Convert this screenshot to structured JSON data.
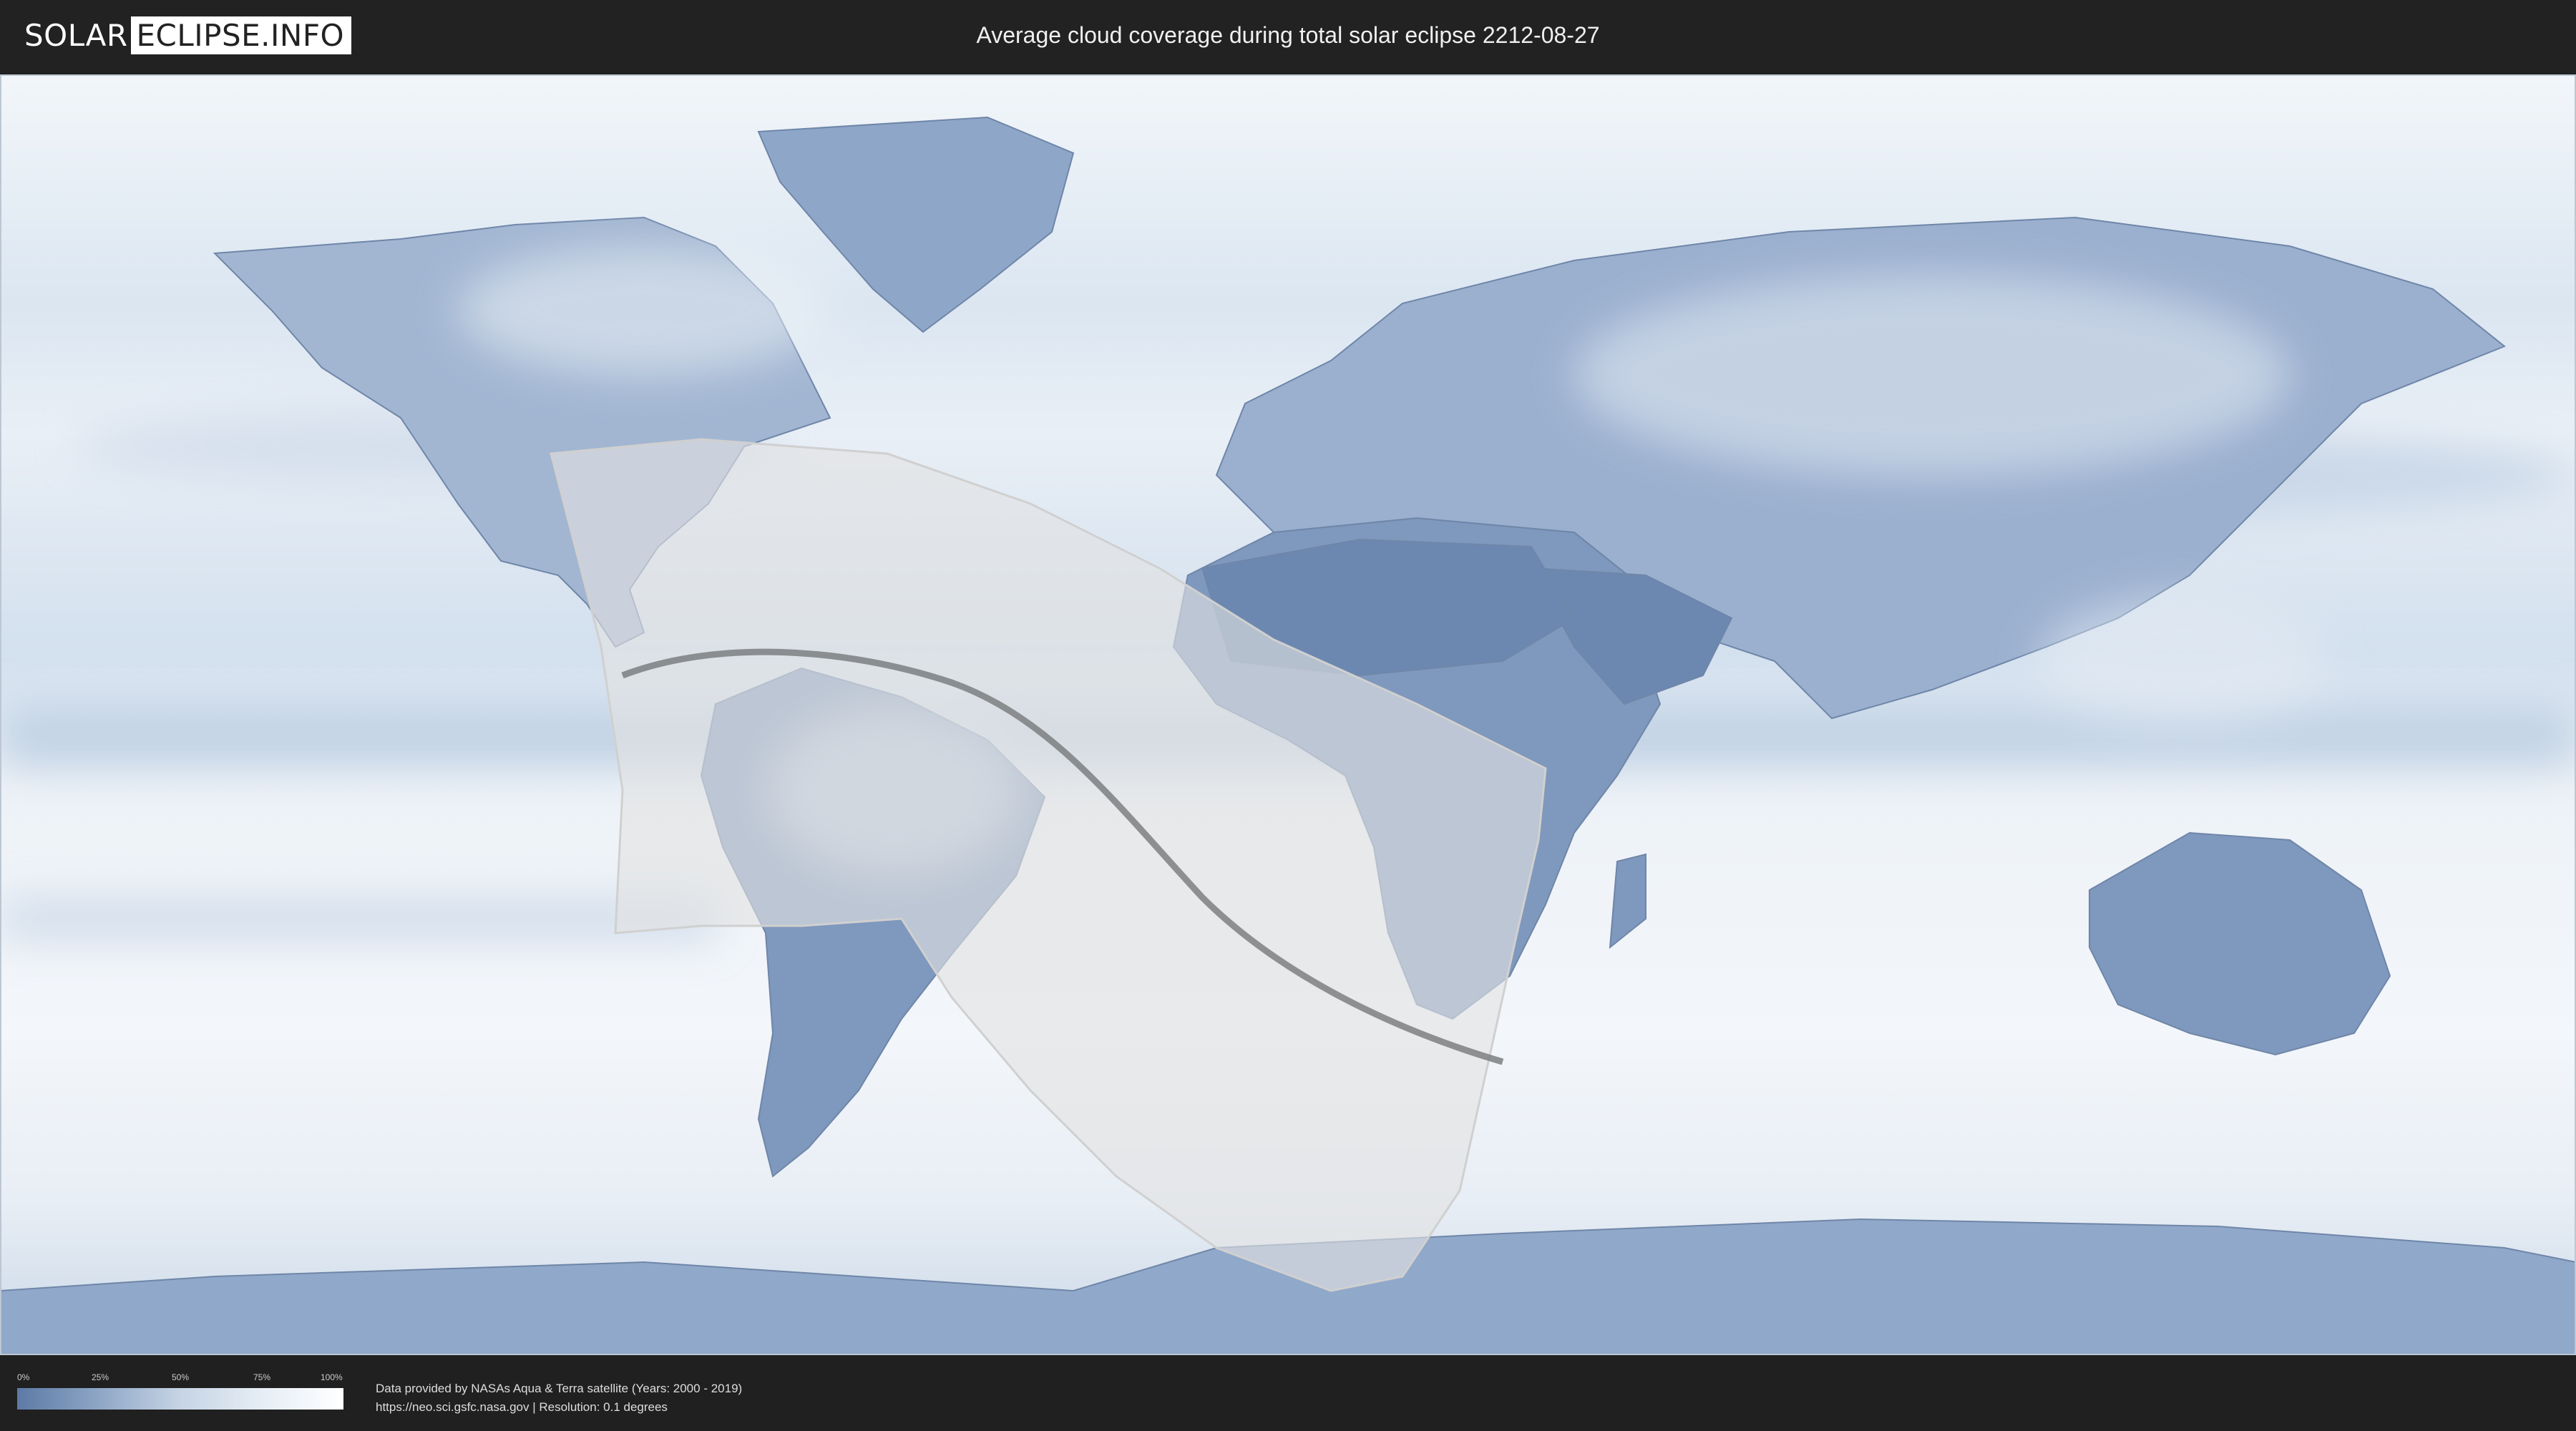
{
  "header": {
    "logo_left": "SOLAR",
    "logo_right": "ECLIPSE.INFO",
    "title": "Average cloud coverage during total solar eclipse 2212-08-27"
  },
  "legend": {
    "ticks": [
      "0%",
      "25%",
      "50%",
      "75%",
      "100%"
    ],
    "colors": [
      "#5d7aa5",
      "#8ea6c6",
      "#c6d4e4",
      "#e6edf5",
      "#ffffff"
    ]
  },
  "credits": {
    "line1": "Data provided by NASAs Aqua & Terra satellite (Years: 2000 - 2019)",
    "line2": "https://neo.sci.gsfc.nasa.gov | Resolution: 0.1 degrees"
  },
  "colors": {
    "header_bg": "#222222",
    "land_clear": "#5d7aa5",
    "cloud_full": "#ffffff",
    "eclipse_shade": "#e2e2e2",
    "central_path": "#7d7f81"
  }
}
